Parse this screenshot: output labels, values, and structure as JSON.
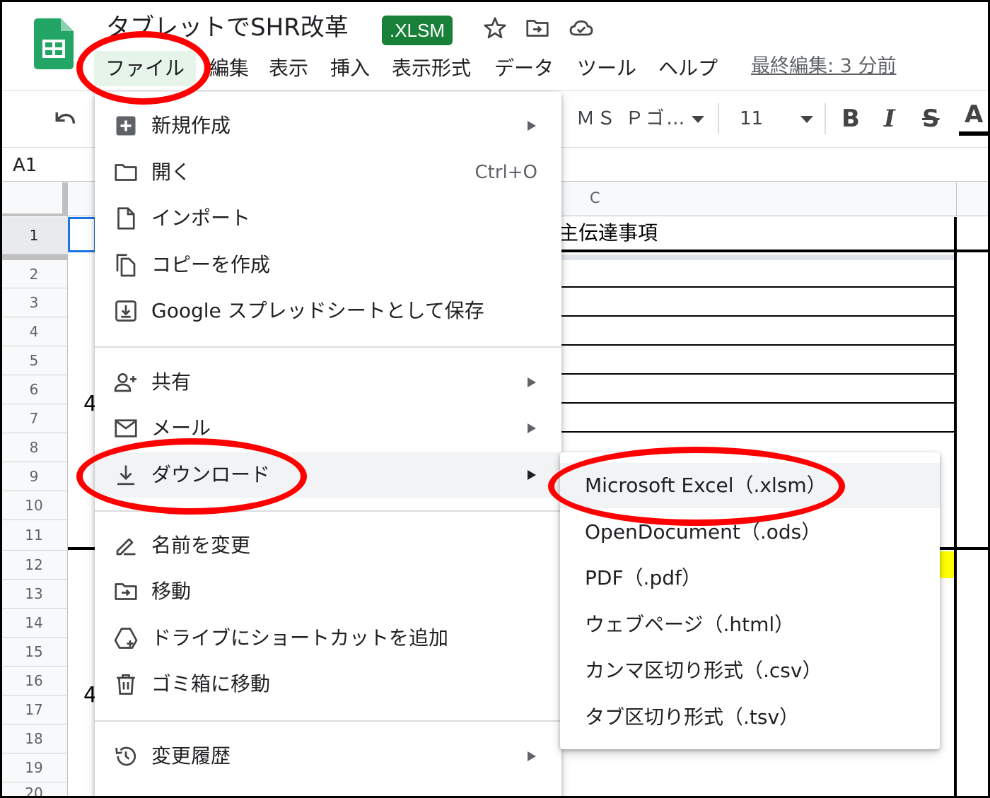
{
  "header": {
    "doc_title": "タブレットでSHR改革",
    "badge": ".XLSM",
    "last_edit": "最終編集: 3 分前",
    "icons": [
      "star-icon",
      "move-folder-icon",
      "cloud-status-icon"
    ]
  },
  "menubar": {
    "items": [
      {
        "label": "ファイル"
      },
      {
        "label": "編集"
      },
      {
        "label": "表示"
      },
      {
        "label": "挿入"
      },
      {
        "label": "表示形式"
      },
      {
        "label": "データ"
      },
      {
        "label": "ツール"
      },
      {
        "label": "ヘルプ"
      }
    ]
  },
  "toolbar": {
    "font": "ＭＳ Ｐゴ…",
    "font_size": "11",
    "bold": "B",
    "italic": "I",
    "strike": "S",
    "text_color": "A"
  },
  "formula_bar": {
    "name_box": "A1"
  },
  "grid": {
    "column_header": "C",
    "rows": [
      "1",
      "2",
      "3",
      "4",
      "5",
      "6",
      "7",
      "8",
      "9",
      "10",
      "11",
      "12",
      "13",
      "14",
      "15",
      "16",
      "17",
      "18",
      "19",
      "20"
    ],
    "cell_c1": "主伝達事項",
    "partial_left_a": "4",
    "partial_left_b": "4",
    "highlight_color": "#ffff00"
  },
  "file_menu": {
    "items": [
      {
        "label": "新規作成",
        "icon": "new-sheet-icon",
        "submenu": true
      },
      {
        "label": "開く",
        "icon": "folder-icon",
        "shortcut": "Ctrl+O"
      },
      {
        "label": "インポート",
        "icon": "import-file-icon"
      },
      {
        "label": "コピーを作成",
        "icon": "copy-icon"
      },
      {
        "label": "Google スプレッドシートとして保存",
        "icon": "save-as-sheets-icon"
      },
      {
        "label": "共有",
        "icon": "share-person-icon",
        "submenu": true
      },
      {
        "label": "メール",
        "icon": "mail-icon",
        "submenu": true
      },
      {
        "label": "ダウンロード",
        "icon": "download-icon",
        "submenu": true
      },
      {
        "label": "名前を変更",
        "icon": "rename-icon"
      },
      {
        "label": "移動",
        "icon": "move-icon"
      },
      {
        "label": "ドライブにショートカットを追加",
        "icon": "drive-shortcut-icon"
      },
      {
        "label": "ゴミ箱に移動",
        "icon": "trash-icon"
      },
      {
        "label": "変更履歴",
        "icon": "history-icon",
        "submenu": true
      }
    ]
  },
  "download_submenu": {
    "items": [
      {
        "label": "Microsoft Excel（.xlsm）"
      },
      {
        "label": "OpenDocument（.ods）"
      },
      {
        "label": "PDF（.pdf）"
      },
      {
        "label": "ウェブページ（.html）"
      },
      {
        "label": "カンマ区切り形式（.csv）"
      },
      {
        "label": "タブ区切り形式（.tsv）"
      }
    ]
  },
  "colors": {
    "accent_green": "#188038",
    "annotation_red": "#ff0000",
    "selection_blue": "#1a73e8"
  }
}
